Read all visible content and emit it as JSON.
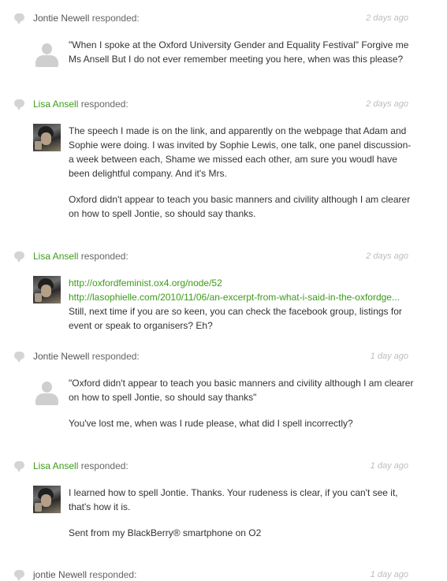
{
  "comments": [
    {
      "author": "Jontie Newell",
      "responded": "responded:",
      "time": "2 days ago",
      "paragraphs": [
        "\"When I spoke at the Oxford University Gender and Equality Festival\" Forgive me Ms Ansell But I do not ever remember meeting you here, when was this please?"
      ]
    },
    {
      "author": "Lisa Ansell",
      "responded": "responded:",
      "time": "2 days ago",
      "paragraphs": [
        "The speech I made is on the link, and apparently on the webpage that Adam and Sophie were doing. I was invited by Sophie Lewis, one talk, one panel discussion- a week between each, Shame we missed each other, am sure you woudl have been delightful company. And it's Mrs.",
        "Oxford didn't appear to teach you basic manners and civility although I am clearer on how to spell Jontie, so should say thanks."
      ]
    },
    {
      "author": "Lisa Ansell",
      "responded": "responded:",
      "time": "2 days ago",
      "links": [
        "http://oxfordfeminist.ox4.org/node/52",
        "http://lasophielle.com/2010/11/06/an-excerpt-from-what-i-said-in-the-oxfordge..."
      ],
      "paragraphs": [
        "Still, next time if you are so keen, you can check the facebook group, listings for event or speak to organisers? Eh?"
      ]
    },
    {
      "author": "Jontie Newell",
      "responded": "responded:",
      "time": "1 day ago",
      "paragraphs": [
        "\"Oxford didn't appear to teach you basic manners and civility although I am clearer on how to spell Jontie, so should say thanks\"",
        "You've lost me, when was I rude please, what did I spell incorrectly?"
      ]
    },
    {
      "author": "Lisa Ansell",
      "responded": "responded:",
      "time": "1 day ago",
      "paragraphs": [
        "I learned how to spell Jontie. Thanks. Your rudeness is clear, if you can't see it, that's how it is.",
        "Sent from my BlackBerry® smartphone on O2"
      ]
    },
    {
      "author": "jontie Newell",
      "responded": "responded:",
      "time": "1 day ago"
    }
  ],
  "icons": {
    "comment_bubble": "speech-bubble-icon",
    "default_avatar": "default-user-avatar",
    "photo_avatar": "user-photo-avatar"
  },
  "colors": {
    "author_link": "#3d9a1a",
    "timestamp": "#bdbdbd",
    "bubble": "#d4d4d4"
  }
}
